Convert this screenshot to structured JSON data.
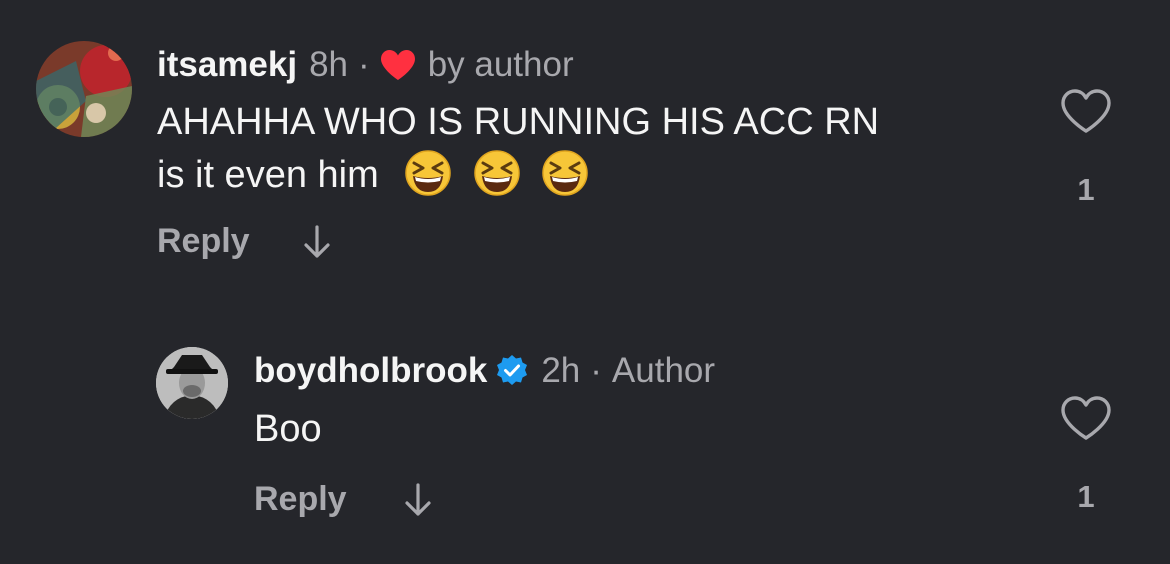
{
  "comments": [
    {
      "username": "itsamekj",
      "time": "8h",
      "separator": "·",
      "badge_text": "by author",
      "text_line1": "AHAHHA WHO IS RUNNING HIS ACC RN",
      "text_line2": "is it even him",
      "reply_label": "Reply",
      "like_count": "1"
    },
    {
      "username": "boydholbrook",
      "time": "2h",
      "separator": "·",
      "badge_text": "Author",
      "text_line1": "Boo",
      "reply_label": "Reply",
      "like_count": "1"
    }
  ],
  "colors": {
    "background": "#25262b",
    "text_primary": "#f5f5f5",
    "text_secondary": "#a8a8ad",
    "heart_red": "#ff3040",
    "verified_blue": "#1d9bf0"
  },
  "icons": {
    "liked_by_author": "red-heart-icon",
    "verified": "verified-badge-icon",
    "like": "heart-outline-icon",
    "expand_replies": "arrow-down-icon",
    "emoji": "grinning-squinting-face"
  }
}
